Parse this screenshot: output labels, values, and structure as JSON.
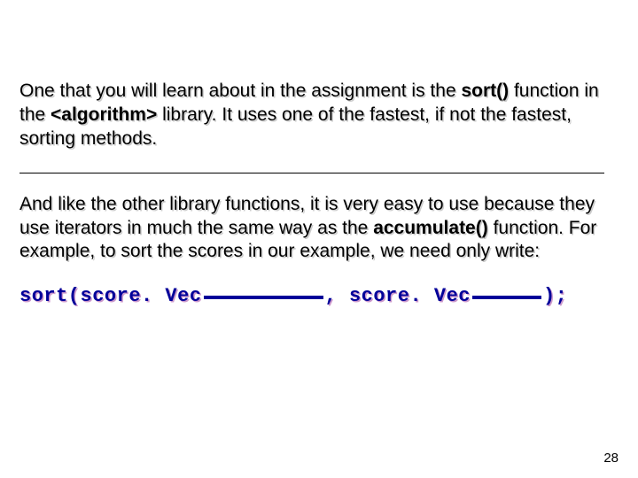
{
  "para1": {
    "t1": "One that you will learn about in the assignment is the ",
    "b1": "sort()",
    "t2": " function in the ",
    "b2": "<algorithm>",
    "t3": " library. It uses one of the fastest, if not the fastest, sorting methods."
  },
  "para2": {
    "t1": "And like the other library functions, it is very easy to use because they use iterators in much the same way as the ",
    "b1": "accumulate()",
    "t2": " function.  For example, to sort the scores in our example, we need only write:"
  },
  "code": {
    "c1": "sort(score. Vec",
    "c2": ",  score. Vec",
    "c3": ");"
  },
  "pagenum": "28"
}
